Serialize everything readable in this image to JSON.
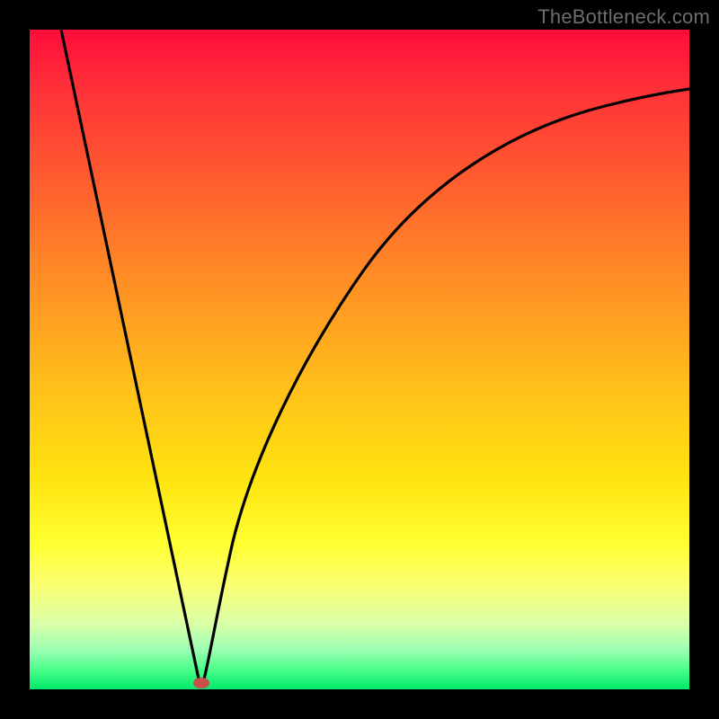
{
  "watermark": "TheBottleneck.com",
  "colors": {
    "frame": "#000000",
    "gradient_top": "#ff0c3a",
    "gradient_mid": "#ffe410",
    "gradient_bottom": "#00e86a",
    "curve": "#000000",
    "marker": "#c94f4b"
  },
  "chart_data": {
    "type": "line",
    "title": "",
    "xlabel": "",
    "ylabel": "",
    "xlim": [
      0,
      100
    ],
    "ylim": [
      0,
      100
    ],
    "grid": false,
    "legend": false,
    "annotations": [
      {
        "text": "TheBottleneck.com",
        "position": "top-right"
      }
    ],
    "marker": {
      "x": 26,
      "y": 1
    },
    "series": [
      {
        "name": "left-branch",
        "x": [
          5,
          10,
          15,
          20,
          24,
          26
        ],
        "y": [
          100,
          76,
          52,
          28,
          8,
          1
        ]
      },
      {
        "name": "right-branch",
        "x": [
          26,
          28,
          30,
          34,
          40,
          48,
          58,
          70,
          82,
          92,
          100
        ],
        "y": [
          1,
          6,
          16,
          35,
          55,
          68,
          77,
          83,
          87,
          89,
          90
        ]
      }
    ]
  }
}
